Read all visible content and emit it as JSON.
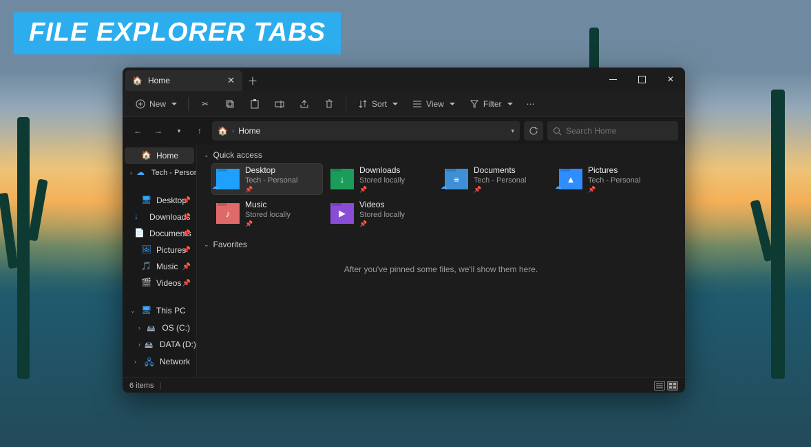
{
  "banner": "FILE EXPLORER TABS",
  "tab": {
    "title": "Home",
    "icon": "home-icon"
  },
  "toolbar": {
    "new": "New",
    "sort": "Sort",
    "view": "View",
    "filter": "Filter"
  },
  "address": {
    "segment": "Home"
  },
  "search": {
    "placeholder": "Search Home"
  },
  "sidebar": {
    "home": "Home",
    "account": "Tech - Personal",
    "pinned": [
      {
        "label": "Desktop",
        "icon": "desktop",
        "color": "#2fa8ff"
      },
      {
        "label": "Downloads",
        "icon": "download",
        "color": "#2fa8ff"
      },
      {
        "label": "Documents",
        "icon": "document",
        "color": "#8fb5d4"
      },
      {
        "label": "Pictures",
        "icon": "picture",
        "color": "#2f9bff"
      },
      {
        "label": "Music",
        "icon": "music",
        "color": "#e86a6a"
      },
      {
        "label": "Videos",
        "icon": "video",
        "color": "#a561ff"
      }
    ],
    "thispc": "This PC",
    "drives": [
      {
        "label": "OS (C:)"
      },
      {
        "label": "DATA (D:)"
      }
    ],
    "network": "Network"
  },
  "sections": {
    "quick": "Quick access",
    "favorites": "Favorites",
    "fav_empty": "After you've pinned some files, we'll show them here."
  },
  "quick_items": [
    {
      "name": "Desktop",
      "sub": "Tech - Personal",
      "color": "#1fa0ff",
      "glyph": "",
      "cloud": true,
      "selected": true
    },
    {
      "name": "Downloads",
      "sub": "Stored locally",
      "color": "#1c9c5b",
      "glyph": "↓",
      "cloud": false,
      "selected": false
    },
    {
      "name": "Documents",
      "sub": "Tech - Personal",
      "color": "#3d8fd6",
      "glyph": "≡",
      "cloud": true,
      "selected": false
    },
    {
      "name": "Pictures",
      "sub": "Tech - Personal",
      "color": "#2f8dff",
      "glyph": "▲",
      "cloud": true,
      "selected": false
    },
    {
      "name": "Music",
      "sub": "Stored locally",
      "color": "#e06a6a",
      "glyph": "♪",
      "cloud": false,
      "selected": false
    },
    {
      "name": "Videos",
      "sub": "Stored locally",
      "color": "#8a4dd6",
      "glyph": "▶",
      "cloud": false,
      "selected": false
    }
  ],
  "status": {
    "count": "6 items"
  }
}
